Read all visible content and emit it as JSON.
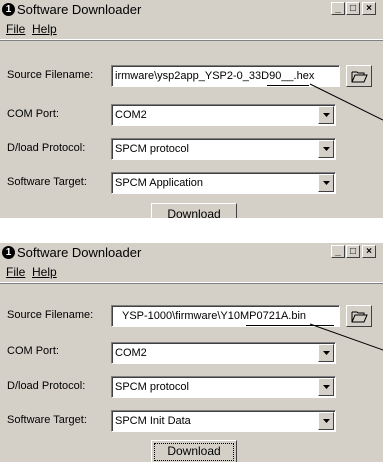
{
  "windows": [
    {
      "title": "Software Downloader",
      "app_icon": "1",
      "controls": {
        "minimize": "_",
        "maximize": "□",
        "close": "×"
      },
      "menu": {
        "file": "File",
        "help": "Help"
      },
      "source": {
        "label": "Source Filename:",
        "value": "irmware\\ysp2app_YSP2-0_33D90__.hex"
      },
      "com": {
        "label": "COM Port:",
        "value": "COM2"
      },
      "protocol": {
        "label": "D/load Protocol:",
        "value": "SPCM protocol"
      },
      "target": {
        "label": "Software Target:",
        "value": "SPCM Application"
      },
      "download": "Download"
    },
    {
      "title": "Software Downloader",
      "app_icon": "1",
      "controls": {
        "minimize": "_",
        "maximize": "□",
        "close": "×"
      },
      "menu": {
        "file": "File",
        "help": "Help"
      },
      "source": {
        "label": "Source Filename:",
        "value": "YSP-1000\\firmware\\Y10MP0721A.bin"
      },
      "com": {
        "label": "COM Port:",
        "value": "COM2"
      },
      "protocol": {
        "label": "D/load Protocol:",
        "value": "SPCM protocol"
      },
      "target": {
        "label": "Software Target:",
        "value": "SPCM Init Data"
      },
      "download": "Download"
    }
  ],
  "icons": {
    "browse": "folder-open-icon",
    "dropdown": "chevron-down-icon"
  }
}
